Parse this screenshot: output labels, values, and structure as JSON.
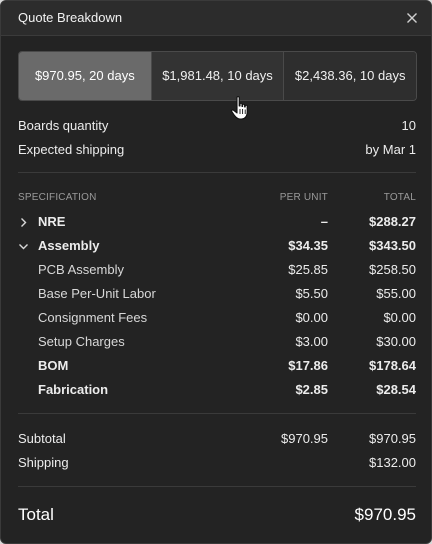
{
  "dialog": {
    "title": "Quote Breakdown"
  },
  "options": [
    {
      "label": "$970.95, 20 days"
    },
    {
      "label": "$1,981.48, 10 days"
    },
    {
      "label": "$2,438.36, 10 days"
    }
  ],
  "meta": {
    "boards_label": "Boards quantity",
    "boards_value": "10",
    "shipping_label": "Expected shipping",
    "shipping_value": "by Mar 1"
  },
  "table": {
    "headers": {
      "spec": "SPECIFICATION",
      "per_unit": "PER UNIT",
      "total": "TOTAL"
    },
    "rows": [
      {
        "label": "NRE",
        "per_unit": "–",
        "total": "$288.27"
      },
      {
        "label": "Assembly",
        "per_unit": "$34.35",
        "total": "$343.50"
      },
      {
        "label": "PCB Assembly",
        "per_unit": "$25.85",
        "total": "$258.50"
      },
      {
        "label": "Base Per-Unit Labor",
        "per_unit": "$5.50",
        "total": "$55.00"
      },
      {
        "label": "Consignment Fees",
        "per_unit": "$0.00",
        "total": "$0.00"
      },
      {
        "label": "Setup Charges",
        "per_unit": "$3.00",
        "total": "$30.00"
      },
      {
        "label": "BOM",
        "per_unit": "$17.86",
        "total": "$178.64"
      },
      {
        "label": "Fabrication",
        "per_unit": "$2.85",
        "total": "$28.54"
      }
    ]
  },
  "summary": {
    "subtotal_label": "Subtotal",
    "subtotal_per_unit": "$970.95",
    "subtotal_total": "$970.95",
    "shipping_label": "Shipping",
    "shipping_total": "$132.00",
    "total_label": "Total",
    "total_value": "$970.95"
  }
}
